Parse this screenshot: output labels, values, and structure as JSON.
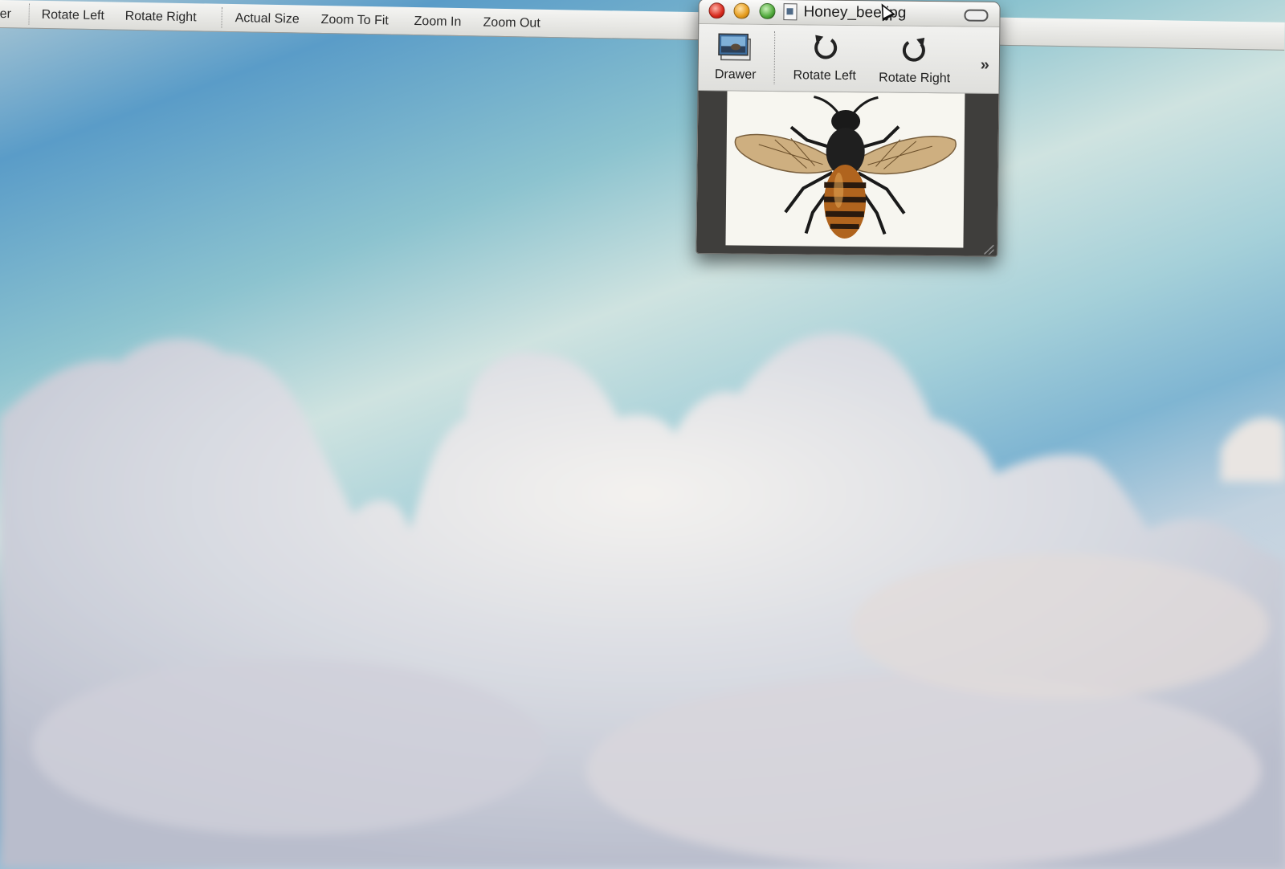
{
  "back_window": {
    "toolbar": {
      "partial_label": "er",
      "items": [
        "Rotate Left",
        "Rotate Right",
        "Actual Size",
        "Zoom To Fit",
        "Zoom In",
        "Zoom Out"
      ]
    }
  },
  "preview_window": {
    "title": "Honey_bee.jpg",
    "toolbar": {
      "drawer_label": "Drawer",
      "rotate_left_label": "Rotate Left",
      "rotate_right_label": "Rotate Right",
      "overflow_glyph": "»"
    },
    "image": {
      "subject": "honey-bee-illustration"
    }
  },
  "desktop": {
    "wallpaper": "sky-with-clouds"
  },
  "colors": {
    "close": "#d6281b",
    "minimize": "#e59b1c",
    "zoom": "#4fa83a"
  }
}
